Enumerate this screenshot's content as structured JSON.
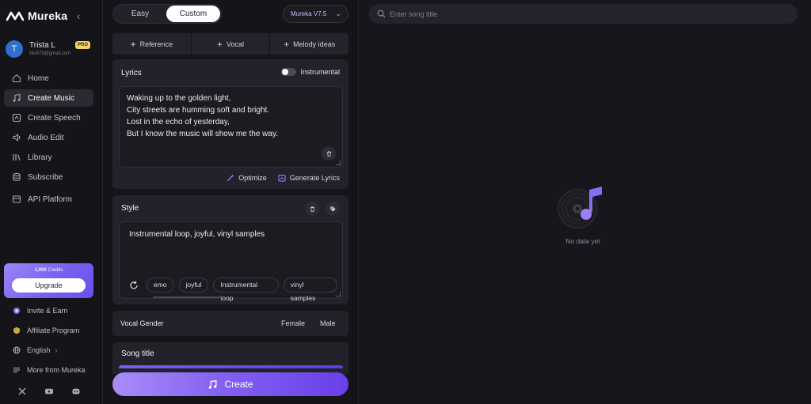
{
  "brand": {
    "name": "Mureka"
  },
  "user": {
    "initial": "T",
    "name": "Trista L",
    "badge": "PRO",
    "email": "liliu979@gmail.com"
  },
  "nav": {
    "items": [
      {
        "label": "Home",
        "icon": "home-icon"
      },
      {
        "label": "Create Music",
        "icon": "music-note-icon",
        "active": true
      },
      {
        "label": "Create Speech",
        "icon": "speech-icon"
      },
      {
        "label": "Audio Edit",
        "icon": "audio-edit-icon"
      },
      {
        "label": "Library",
        "icon": "library-icon"
      },
      {
        "label": "Subscribe",
        "icon": "database-icon"
      },
      {
        "label": "API Platform",
        "icon": "api-icon"
      }
    ]
  },
  "credits": {
    "amount": "1,000",
    "label": "Credits",
    "upgrade_label": "Upgrade"
  },
  "bottom_links": {
    "invite": "Invite & Earn",
    "affiliate": "Affiliate Program",
    "language": "English",
    "more": "More from Mureka"
  },
  "socials": [
    "x-icon",
    "youtube-icon",
    "discord-icon"
  ],
  "mode": {
    "easy": "Easy",
    "custom": "Custom",
    "selected": "Custom"
  },
  "model": {
    "label": "Mureka V7.5"
  },
  "options": {
    "reference": "Reference",
    "vocal": "Vocal",
    "melody": "Melody ideas"
  },
  "lyrics": {
    "title": "Lyrics",
    "instrumental_label": "Instrumental",
    "instrumental_on": false,
    "lines": [
      "Waking up to the golden light,",
      "City streets are humming soft and bright.",
      "Lost in the echo of yesterday,",
      "But I know the music will show me the way."
    ],
    "optimize_label": "Optimize",
    "generate_label": "Generate Lyrics"
  },
  "style": {
    "title": "Style",
    "text": "Instrumental loop, joyful, vinyl samples",
    "tags": [
      "emo",
      "joyful",
      "Instrumental loop",
      "vinyl samples"
    ]
  },
  "vocal_gender": {
    "label": "Vocal Gender",
    "female": "Female",
    "male": "Male"
  },
  "song_title": {
    "title": "Song title"
  },
  "create": {
    "label": "Create"
  },
  "search": {
    "placeholder": "Enter song title",
    "value": ""
  },
  "empty_state": {
    "text": "No data yet"
  },
  "colors": {
    "accent": "#8462f2",
    "accent_light": "#a98df8",
    "background": "#16161d",
    "card": "#22222a"
  }
}
